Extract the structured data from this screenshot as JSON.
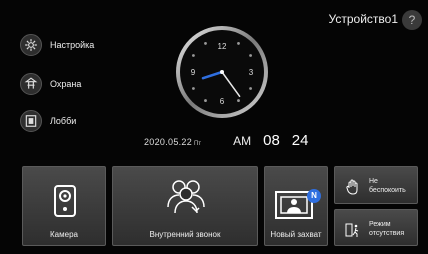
{
  "header": {
    "device_name": "Устройство1",
    "help_label": "?"
  },
  "sidebar": {
    "items": [
      {
        "label": "Настройка",
        "icon": "gear-icon"
      },
      {
        "label": "Охрана",
        "icon": "security-icon"
      },
      {
        "label": "Лобби",
        "icon": "lobby-icon"
      }
    ]
  },
  "clock": {
    "numbers": [
      "12",
      "3",
      "6",
      "9"
    ],
    "hour_value": 8,
    "minute_value": 24
  },
  "datetime": {
    "date": "2020.05.22",
    "weekday": "Пт",
    "ampm": "AM",
    "hour": "08",
    "minute": "24"
  },
  "tiles": {
    "camera": {
      "label": "Камера",
      "icon": "camera-icon"
    },
    "intercom": {
      "label": "Внутренний звонок",
      "icon": "people-icon"
    },
    "capture": {
      "label": "Новый захват",
      "icon": "photo-icon",
      "badge": "N"
    },
    "dnd": {
      "label_line1": "Не",
      "label_line2": "беспокоить",
      "icon": "hand-icon"
    },
    "away": {
      "label_line1": "Режим",
      "label_line2": "отсутствия",
      "icon": "away-icon"
    }
  },
  "colors": {
    "accent": "#2f6fe0",
    "background": "#050505"
  }
}
